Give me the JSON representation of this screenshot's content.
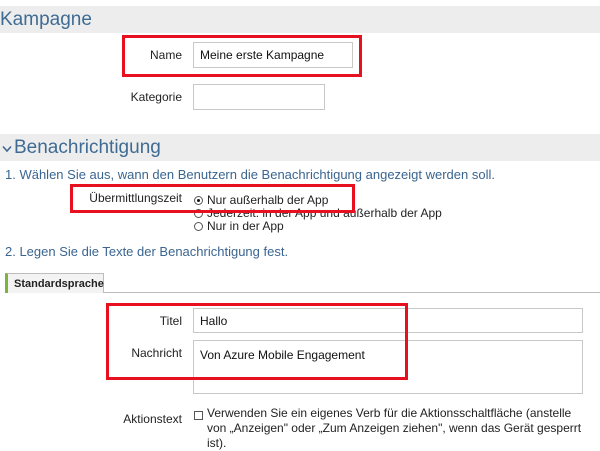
{
  "kampagne": {
    "title": "Kampagne",
    "name_label": "Name",
    "name_value": "Meine erste Kampagne",
    "kategorie_label": "Kategorie",
    "kategorie_value": ""
  },
  "benachrichtigung": {
    "title": "Benachrichtigung",
    "chevron_icon": "chevron-down-icon",
    "step1": "1. Wählen Sie aus, wann den Benutzern die Benachrichtigung angezeigt werden soll.",
    "delivery_label": "Übermittlungszeit",
    "delivery_options": [
      {
        "label": "Nur außerhalb der App",
        "selected": true
      },
      {
        "label": "Jederzeit: in der App und außerhalb der App",
        "selected": false
      },
      {
        "label": "Nur in der App",
        "selected": false
      }
    ],
    "step2": "2. Legen Sie die Texte der Benachrichtigung fest.",
    "tab_label": "Standardsprache",
    "titel_label": "Titel",
    "titel_value": "Hallo",
    "nachricht_label": "Nachricht",
    "nachricht_value": "Von Azure Mobile Engagement",
    "aktionstext_label": "Aktionstext",
    "aktionstext_checkbox_label": "Verwenden Sie ein eigenes Verb für die Aktionsschaltfläche (anstelle von „Anzeigen\" oder „Zum Anzeigen ziehen\", wenn das Gerät gesperrt ist).",
    "aktionstext_checked": false
  },
  "colors": {
    "section_bg": "#ededed",
    "section_title": "#3f6b93",
    "highlight": "#e8101e",
    "tab_accent": "#7fb23a"
  }
}
